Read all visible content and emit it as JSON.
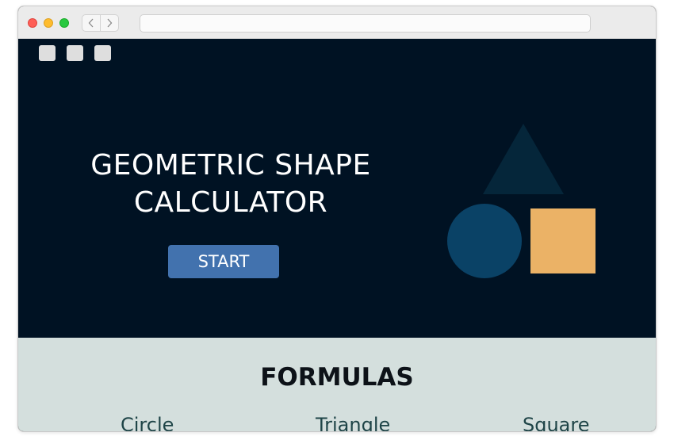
{
  "hero": {
    "title_line1": "GEOMETRIC SHAPE",
    "title_line2": "CALCULATOR",
    "start_label": "START",
    "colors": {
      "background": "#001223",
      "triangle": "#05263a",
      "circle": "#0a4266",
      "square": "#ebb266",
      "button": "#4272ae"
    }
  },
  "formulas": {
    "title": "FORMULAS",
    "shapes": [
      "Circle",
      "Triangle",
      "Square"
    ]
  },
  "browser": {
    "icons": [
      "close-light",
      "minimize-light",
      "zoom-light",
      "chevron-left-icon",
      "chevron-right-icon"
    ]
  }
}
